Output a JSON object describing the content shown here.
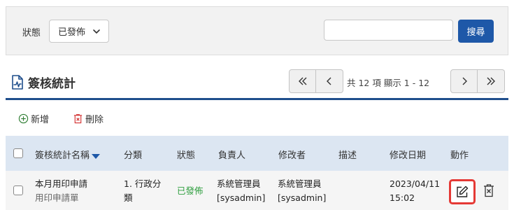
{
  "filter": {
    "status_label": "狀態",
    "status_value": "已發佈",
    "search_placeholder": "",
    "search_button": "搜尋"
  },
  "section": {
    "title": "簽核統計"
  },
  "pager": {
    "info": "共 12 項 顯示 1 - 12"
  },
  "toolbar": {
    "add_label": "新增",
    "delete_label": "刪除"
  },
  "table": {
    "columns": [
      "簽核統計名稱",
      "分類",
      "狀態",
      "負責人",
      "修改者",
      "描述",
      "修改日期",
      "動作"
    ],
    "rows": [
      {
        "name": "本月用印申請",
        "subtitle": "用印申請單",
        "category_line1": "1. 行政分",
        "category_line2": "類",
        "status": "已發佈",
        "owner_line1": "系統管理員",
        "owner_line2": "[sysadmin]",
        "modifier_line1": "系統管理員",
        "modifier_line2": "[sysadmin]",
        "description": "",
        "date_line1": "2023/04/11",
        "date_line2": "15:02"
      }
    ]
  },
  "colors": {
    "primary": "#1e58a8",
    "header_rule": "#1f4e8c",
    "table_header_bg": "#dce6f2",
    "published": "#2e9e3e",
    "delete_red": "#d32f2f",
    "add_green": "#2e7d32",
    "highlight": "#e53935"
  },
  "icons": {
    "status_dropdown": "chevron-down-icon",
    "section": "document-chart-icon",
    "first": "double-chevron-left-icon",
    "prev": "chevron-left-icon",
    "next": "chevron-right-icon",
    "last": "double-chevron-right-icon",
    "add": "plus-circle-icon",
    "delete": "trash-x-icon",
    "sort": "sort-desc-icon",
    "edit": "edit-pencil-icon",
    "row_delete": "delete-x-icon"
  }
}
